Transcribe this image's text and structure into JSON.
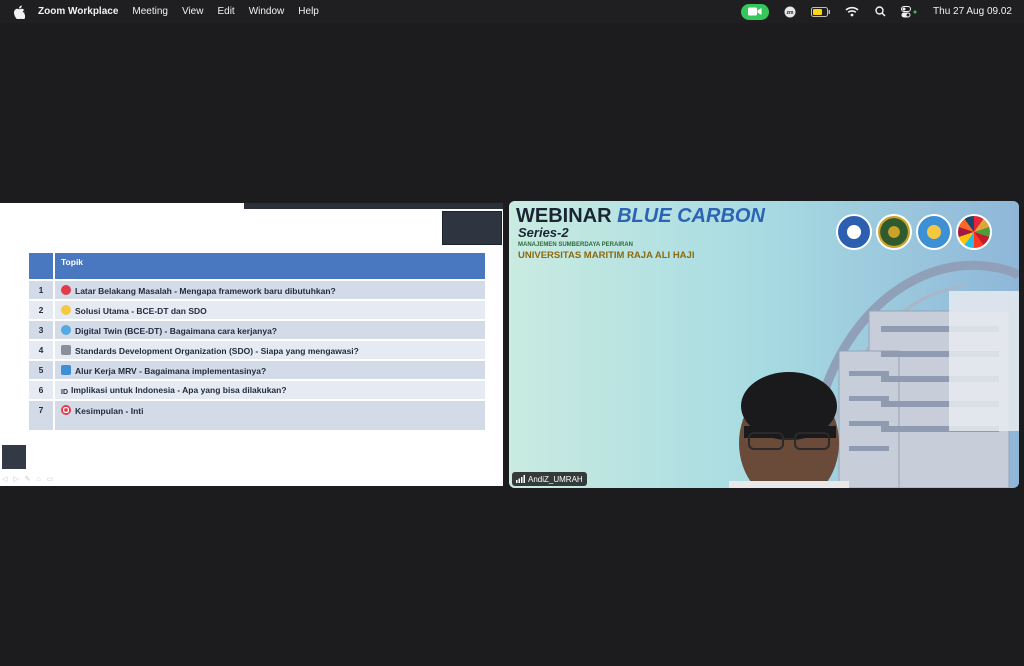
{
  "menubar": {
    "app_name": "Zoom Workplace",
    "menus": [
      "Meeting",
      "View",
      "Edit",
      "Window",
      "Help"
    ],
    "clock": "Thu 27 Aug  09.02"
  },
  "slide": {
    "header": "Topik",
    "rows": [
      {
        "num": "1",
        "icon": "red-apple-icon",
        "text": "Latar Belakang Masalah - Mengapa framework baru dibutuhkan?"
      },
      {
        "num": "2",
        "icon": "lightbulb-icon",
        "text": "Solusi Utama - BCE-DT dan SDO"
      },
      {
        "num": "3",
        "icon": "globe-icon",
        "text": "Digital Twin (BCE-DT) - Bagaimana cara kerjanya?"
      },
      {
        "num": "4",
        "icon": "institution-icon",
        "text": "Standards Development Organization (SDO) - Siapa yang mengawasi?"
      },
      {
        "num": "5",
        "icon": "repeat-icon",
        "text": "Alur Kerja MRV - Bagaimana implementasinya?"
      },
      {
        "num": "6",
        "icon_text": "ID",
        "text": "Implikasi untuk Indonesia - Apa yang bisa dilakukan?"
      },
      {
        "num": "7",
        "icon": "target-icon",
        "text": "Kesimpulan - Inti"
      }
    ]
  },
  "video": {
    "title_main": "WEBINAR ",
    "title_accent": "BLUE CARBON",
    "series": "Series-2",
    "department": "MANAJEMEN SUMBERDAYA PERAIRAN",
    "university": "UNIVERSITAS MARITIM RAJA ALI HAJI",
    "participant_name": "AndiZ_UMRAH"
  }
}
